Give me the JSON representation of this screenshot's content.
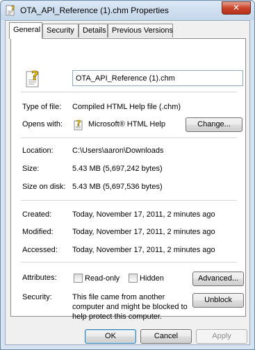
{
  "window": {
    "title": "OTA_API_Reference (1).chm Properties",
    "close_glyph": "✕"
  },
  "tabs": [
    {
      "label": "General",
      "active": true
    },
    {
      "label": "Security",
      "active": false
    },
    {
      "label": "Details",
      "active": false
    },
    {
      "label": "Previous Versions",
      "active": false
    }
  ],
  "general": {
    "file_name": "OTA_API_Reference (1).chm",
    "file_icon": "chm-help-file-icon",
    "type_label": "Type of file:",
    "type_value": "Compiled HTML Help file (.chm)",
    "opens_label": "Opens with:",
    "opens_value": "Microsoft® HTML Help",
    "opens_icon": "html-help-icon",
    "change_button": "Change...",
    "location_label": "Location:",
    "location_value": "C:\\Users\\aaron\\Downloads",
    "size_label": "Size:",
    "size_value": "5.43 MB (5,697,242 bytes)",
    "size_on_disk_label": "Size on disk:",
    "size_on_disk_value": "5.43 MB (5,697,536 bytes)",
    "created_label": "Created:",
    "created_value": "Today, November 17, 2011, 2 minutes ago",
    "modified_label": "Modified:",
    "modified_value": "Today, November 17, 2011, 2 minutes ago",
    "accessed_label": "Accessed:",
    "accessed_value": "Today, November 17, 2011, 2 minutes ago",
    "attributes_label": "Attributes:",
    "readonly_label": "Read-only",
    "readonly_checked": false,
    "hidden_label": "Hidden",
    "hidden_checked": false,
    "advanced_button": "Advanced...",
    "security_label": "Security:",
    "security_text_1": "This file came from another",
    "security_text_2": "computer and might be blocked to",
    "security_text_3": "help protect this computer.",
    "unblock_button": "Unblock"
  },
  "footer": {
    "ok": "OK",
    "cancel": "Cancel",
    "apply": "Apply"
  },
  "colors": {
    "frame": "#d6e4f2",
    "close": "#c8432a",
    "dialog_bg": "#f0f0f0",
    "default_button_border": "#3c7fb1"
  }
}
